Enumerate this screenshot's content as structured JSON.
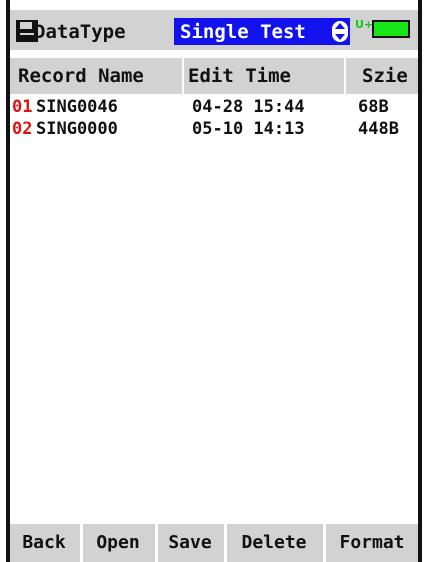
{
  "header": {
    "disk_icon": "floppy-disk-icon",
    "datatype_label": "DataType",
    "datatype_value": "Single Test",
    "usb_indicator": "U+",
    "battery_color": "#17e617",
    "select_color": "#1212ee"
  },
  "columns": {
    "record_name": "Record Name",
    "edit_time": "Edit Time",
    "size": "Szie"
  },
  "records": [
    {
      "index": "01",
      "name": "SING0046",
      "edit_time": "04-28 15:44",
      "size": "68B"
    },
    {
      "index": "02",
      "name": "SING0000",
      "edit_time": "05-10 14:13",
      "size": "448B"
    }
  ],
  "toolbar": {
    "back": "Back",
    "open": "Open",
    "save": "Save",
    "delete": "Delete",
    "format": "Format"
  }
}
